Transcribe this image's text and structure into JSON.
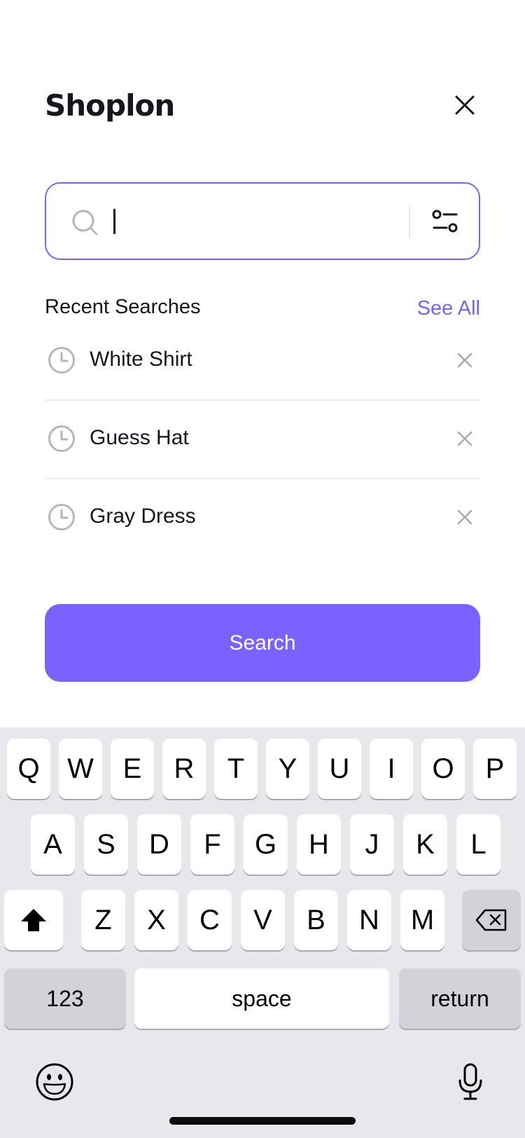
{
  "app": {
    "title": "Shoplon"
  },
  "colors": {
    "accent": "#7b61ff",
    "text": "#16161e",
    "muted": "#9a9aa3",
    "keyboard_bg": "#e8e8ec"
  },
  "header": {
    "close_icon": "close-icon"
  },
  "search": {
    "placeholder": "",
    "value": "",
    "search_icon": "search-icon",
    "filter_icon": "filter-icon"
  },
  "recent": {
    "title": "Recent Searches",
    "see_all": "See All",
    "items": [
      {
        "label": "White Shirt",
        "icon": "clock-icon",
        "remove_icon": "close-icon"
      },
      {
        "label": "Guess Hat",
        "icon": "clock-icon",
        "remove_icon": "close-icon"
      },
      {
        "label": "Gray Dress",
        "icon": "clock-icon",
        "remove_icon": "close-icon"
      }
    ]
  },
  "search_button": {
    "label": "Search"
  },
  "keyboard": {
    "row1": [
      "Q",
      "W",
      "E",
      "R",
      "T",
      "Y",
      "U",
      "I",
      "O",
      "P"
    ],
    "row2": [
      "A",
      "S",
      "D",
      "F",
      "G",
      "H",
      "J",
      "K",
      "L"
    ],
    "row3": [
      "Z",
      "X",
      "C",
      "V",
      "B",
      "N",
      "M"
    ],
    "shift_icon": "shift-icon",
    "backspace_icon": "backspace-icon",
    "numbers_label": "123",
    "space_label": "space",
    "return_label": "return",
    "emoji_icon": "emoji-icon",
    "mic_icon": "microphone-icon"
  }
}
